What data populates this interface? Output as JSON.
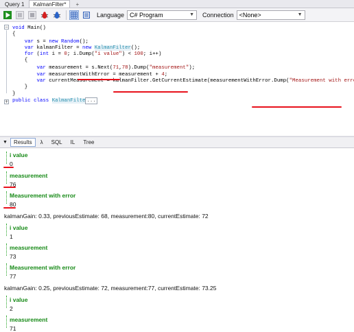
{
  "tabs": [
    {
      "label": "Query 1"
    },
    {
      "label": "KalmanFilter*"
    },
    {
      "label": "+"
    }
  ],
  "toolbar": {
    "language_label": "Language",
    "language_value": "C# Program",
    "connection_label": "Connection",
    "connection_value": "<None>"
  },
  "code": {
    "lines": [
      {
        "segments": [
          {
            "t": "void",
            "c": "kw"
          },
          {
            "t": " Main()",
            "c": ""
          }
        ]
      },
      {
        "segments": [
          {
            "t": "{",
            "c": ""
          }
        ]
      },
      {
        "segments": [
          {
            "t": "    var",
            "c": "kw"
          },
          {
            "t": " s = ",
            "c": ""
          },
          {
            "t": "new",
            "c": "kw"
          },
          {
            "t": " ",
            "c": ""
          },
          {
            "t": "Random",
            "c": "kw"
          },
          {
            "t": "();",
            "c": ""
          }
        ]
      },
      {
        "segments": [
          {
            "t": "    var",
            "c": "kw"
          },
          {
            "t": " kalmanFilter = ",
            "c": ""
          },
          {
            "t": "new",
            "c": "kw"
          },
          {
            "t": " ",
            "c": ""
          },
          {
            "t": "KalmanFilter",
            "c": "typ"
          },
          {
            "t": "();",
            "c": ""
          }
        ]
      },
      {
        "segments": [
          {
            "t": "    for",
            "c": "kw"
          },
          {
            "t": " (",
            "c": ""
          },
          {
            "t": "int",
            "c": "kw"
          },
          {
            "t": " i = ",
            "c": ""
          },
          {
            "t": "0",
            "c": "num"
          },
          {
            "t": "; i.Dump(",
            "c": ""
          },
          {
            "t": "\"i value\"",
            "c": "str"
          },
          {
            "t": ") < ",
            "c": ""
          },
          {
            "t": "100",
            "c": "num"
          },
          {
            "t": "; i++)",
            "c": ""
          }
        ]
      },
      {
        "segments": [
          {
            "t": "    {",
            "c": ""
          }
        ]
      },
      {
        "segments": [
          {
            "t": "",
            "c": ""
          }
        ]
      },
      {
        "segments": [
          {
            "t": "        var",
            "c": "kw"
          },
          {
            "t": " measurement = s.Next(",
            "c": ""
          },
          {
            "t": "71",
            "c": "num"
          },
          {
            "t": ",",
            "c": ""
          },
          {
            "t": "78",
            "c": "num"
          },
          {
            "t": ").Dump(",
            "c": ""
          },
          {
            "t": "\"measurement\"",
            "c": "str"
          },
          {
            "t": ");",
            "c": ""
          }
        ]
      },
      {
        "segments": [
          {
            "t": "        var",
            "c": "kw"
          },
          {
            "t": " measurementWithError = measurement + ",
            "c": ""
          },
          {
            "t": "4",
            "c": "num"
          },
          {
            "t": ";",
            "c": ""
          }
        ]
      },
      {
        "segments": [
          {
            "t": "        var",
            "c": "kw"
          },
          {
            "t": " currentMeasurement = kalmanFilter.GetCurrentEstimate(measurementWithError.Dump(",
            "c": ""
          },
          {
            "t": "\"Measurement with error\"",
            "c": "str"
          },
          {
            "t": "));",
            "c": ""
          }
        ]
      },
      {
        "segments": [
          {
            "t": "    }",
            "c": ""
          }
        ]
      },
      {
        "segments": [
          {
            "t": "}",
            "c": ""
          }
        ]
      },
      {
        "segments": [
          {
            "t": "public",
            "c": "kw"
          },
          {
            "t": " ",
            "c": ""
          },
          {
            "t": "class",
            "c": "kw"
          },
          {
            "t": " ",
            "c": ""
          },
          {
            "t": "KalmanFilte",
            "c": "typ"
          },
          {
            "t": "...",
            "c": "box"
          }
        ]
      }
    ]
  },
  "results_tabs": [
    {
      "label": "Results"
    },
    {
      "label": "λ"
    },
    {
      "label": "SQL"
    },
    {
      "label": "IL"
    },
    {
      "label": "Tree"
    }
  ],
  "results": [
    {
      "type": "dump",
      "header": "i value",
      "value": "0"
    },
    {
      "type": "dump",
      "header": "measurement",
      "value": "76"
    },
    {
      "type": "dump",
      "header": "Measurement with error",
      "value": "80"
    },
    {
      "type": "text",
      "value": "kalmanGain: 0.33, previousEstimate: 68, measurement:80, currentEstimate: 72"
    },
    {
      "type": "dump",
      "header": "i value",
      "value": "1"
    },
    {
      "type": "dump",
      "header": "measurement",
      "value": "73"
    },
    {
      "type": "dump",
      "header": "Measurement with error",
      "value": "77"
    },
    {
      "type": "text",
      "value": "kalmanGain: 0.25, previousEstimate: 72, measurement:77, currentEstimate: 73.25"
    },
    {
      "type": "dump",
      "header": "i value",
      "value": "2"
    },
    {
      "type": "dump",
      "header": "measurement",
      "value": "71"
    }
  ],
  "colors": {
    "accent_green": "#178a17",
    "annotation_red": "#e8101a",
    "keyword_blue": "#0000ff",
    "string_red": "#a31515"
  },
  "icons": [
    "run-icon",
    "stop-icon",
    "pause-icon",
    "bug-icon",
    "settings-bug-icon",
    "grid-view-icon",
    "text-view-icon"
  ]
}
